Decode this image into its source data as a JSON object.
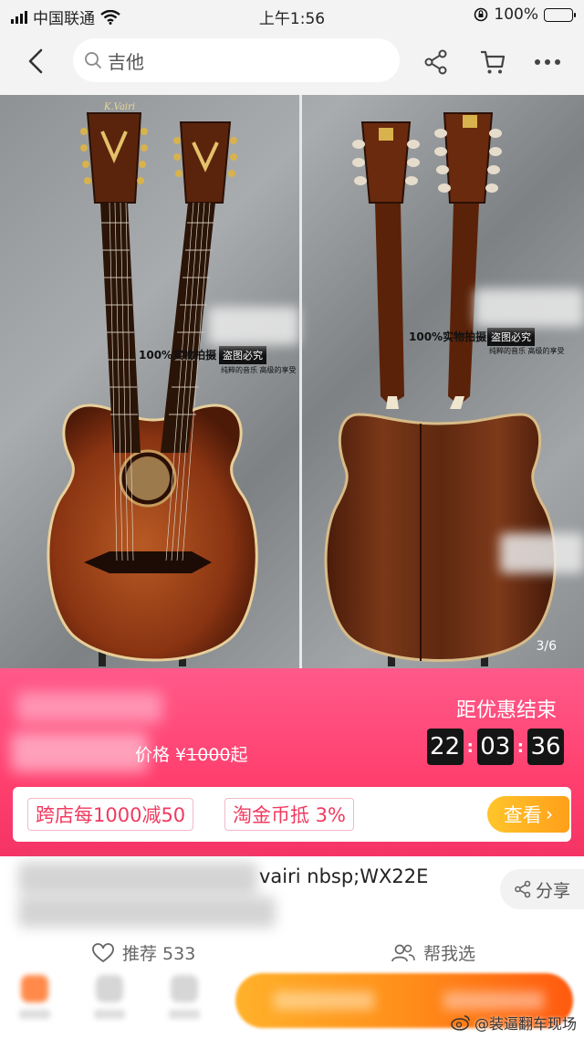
{
  "status_bar": {
    "carrier": "中国联通",
    "time": "上午1:56",
    "battery": "100%"
  },
  "nav": {
    "search_placeholder": "吉他"
  },
  "hero": {
    "image_counter": "3/6",
    "watermark_left": "100%实物拍摄",
    "watermark_left_box": "盗图必究",
    "watermark_left_sub": "纯粹的音乐 高级的享受",
    "watermark_right": "100%实物拍摄",
    "watermark_right_box": "盗图必究",
    "watermark_right_sub": "纯粹的音乐 高级的享受",
    "headstock_logo": "K.Vairi"
  },
  "promo": {
    "price_prefix": "价格 ¥",
    "original_price": "1000",
    "price_suffix": "起",
    "countdown_title": "距优惠结束",
    "countdown": {
      "hours": "22",
      "minutes": "03",
      "seconds": "36"
    },
    "coupon_1": "跨店每1000减50",
    "coupon_2": "淘金币抵 3%",
    "see_button": "查看",
    "see_arrow": "›"
  },
  "product": {
    "title_visible": "vairi nbsp;WX22E",
    "share_label": "分享",
    "recommend_label": "推荐 533",
    "help_choose_label": "帮我选"
  },
  "watermark": {
    "text": "@装逼翻车现场"
  },
  "colors": {
    "promo_pink": "#ff3f6e",
    "coupon_red": "#f03a5f",
    "see_button_orange": "#ffb12a",
    "buy_orange": "#ff8f1a"
  }
}
